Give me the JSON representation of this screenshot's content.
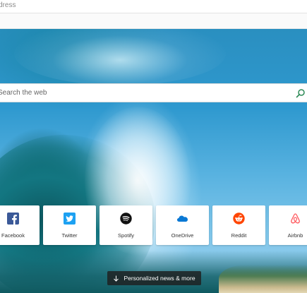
{
  "address_bar": {
    "placeholder": "dress"
  },
  "search": {
    "placeholder": "Search the web",
    "icon": "search-icon",
    "icon_color": "#2e8b57"
  },
  "quick_links": [
    {
      "label": "Facebook",
      "icon": "facebook-icon",
      "color": "#3b5998"
    },
    {
      "label": "Twitter",
      "icon": "twitter-icon",
      "color": "#1da1f2"
    },
    {
      "label": "Spotify",
      "icon": "spotify-icon",
      "color": "#000000"
    },
    {
      "label": "OneDrive",
      "icon": "onedrive-icon",
      "color": "#0a78d4"
    },
    {
      "label": "Reddit",
      "icon": "reddit-icon",
      "color": "#ff4500"
    },
    {
      "label": "Airbnb",
      "icon": "airbnb-icon",
      "color": "#ff5a5f"
    }
  ],
  "news_button": {
    "label": "Personalized news & more",
    "icon": "arrow-down-icon"
  }
}
